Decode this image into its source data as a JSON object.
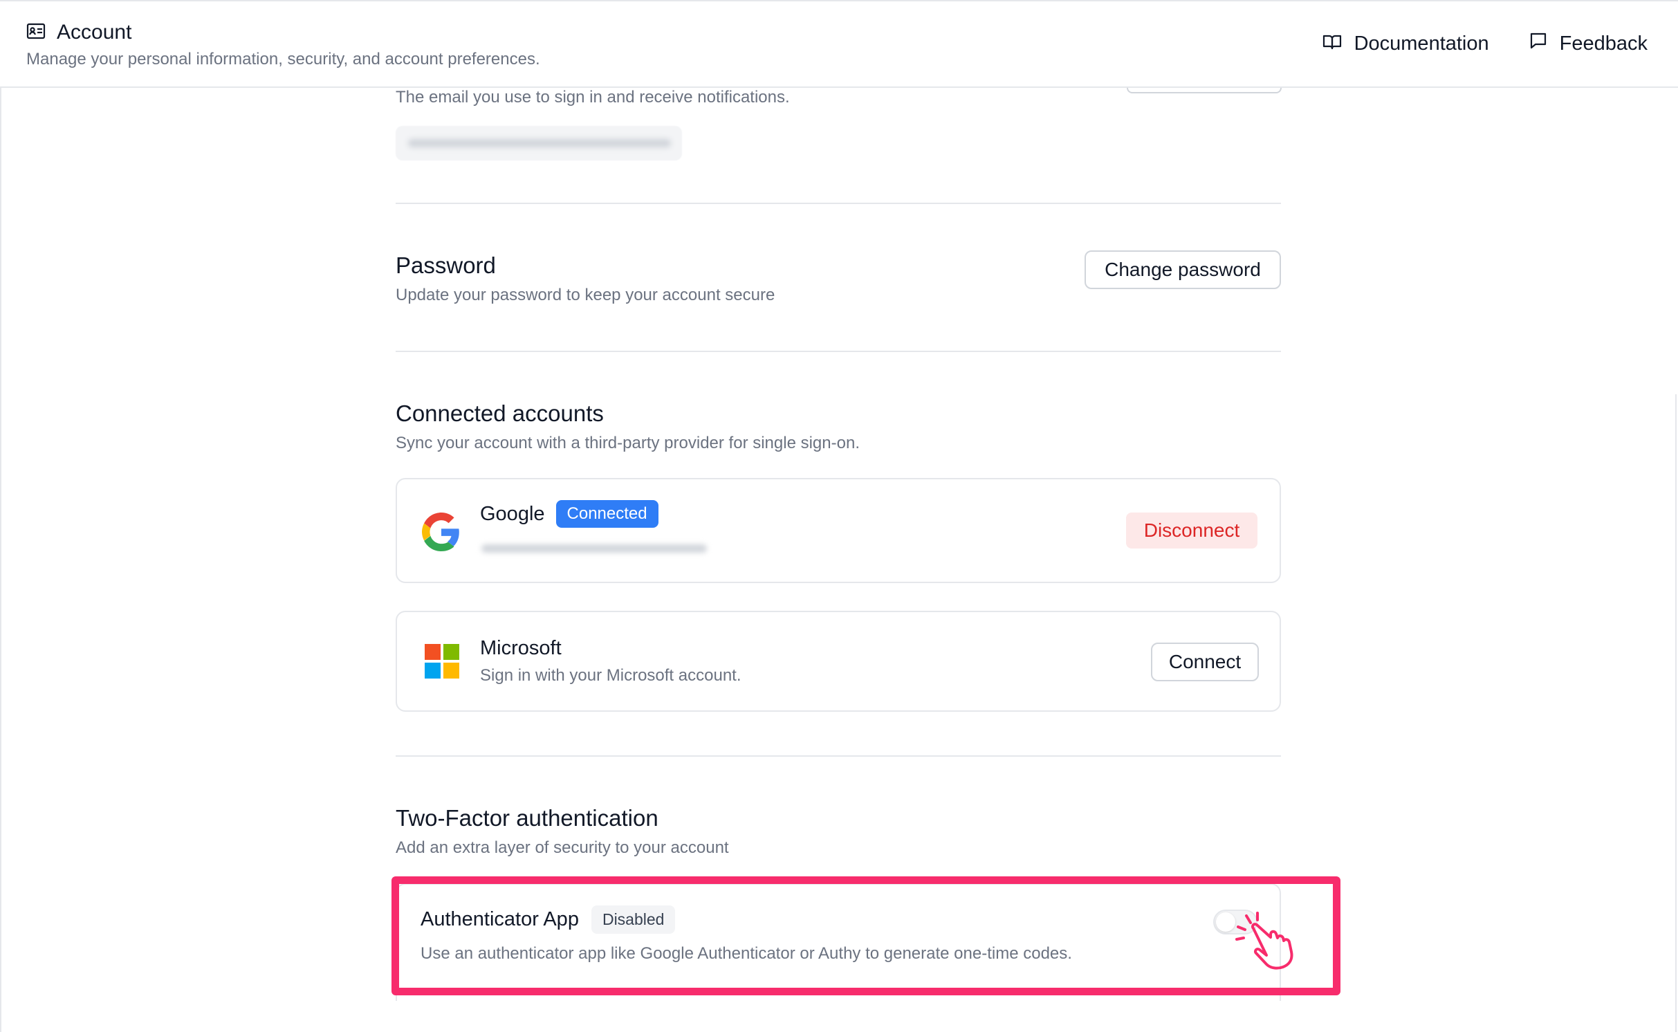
{
  "header": {
    "title": "Account",
    "subtitle": "Manage your personal information, security, and account preferences.",
    "title_icon": "id-card-icon",
    "links": [
      {
        "label": "Documentation",
        "icon": "book-icon"
      },
      {
        "label": "Feedback",
        "icon": "message-square-icon"
      }
    ]
  },
  "email": {
    "description": "The email you use to sign in and receive notifications."
  },
  "password": {
    "title": "Password",
    "description": "Update your password to keep your account secure",
    "button": "Change password"
  },
  "connected_accounts": {
    "title": "Connected accounts",
    "description": "Sync your account with a third-party provider for single sign-on.",
    "providers": [
      {
        "name": "Google",
        "badge": "Connected",
        "action": "Disconnect",
        "icon": "google-icon"
      },
      {
        "name": "Microsoft",
        "description": "Sign in with your Microsoft account.",
        "action": "Connect",
        "icon": "microsoft-icon"
      }
    ]
  },
  "two_factor": {
    "title": "Two-Factor authentication",
    "description": "Add an extra layer of security to your account",
    "method": {
      "name": "Authenticator App",
      "badge": "Disabled",
      "description": "Use an authenticator app like Google Authenticator or Authy to generate one-time codes.",
      "enabled": false
    }
  },
  "colors": {
    "accent_blue": "#2f7df6",
    "danger_red": "#dc2626",
    "highlight_pink": "#f72c6c"
  }
}
